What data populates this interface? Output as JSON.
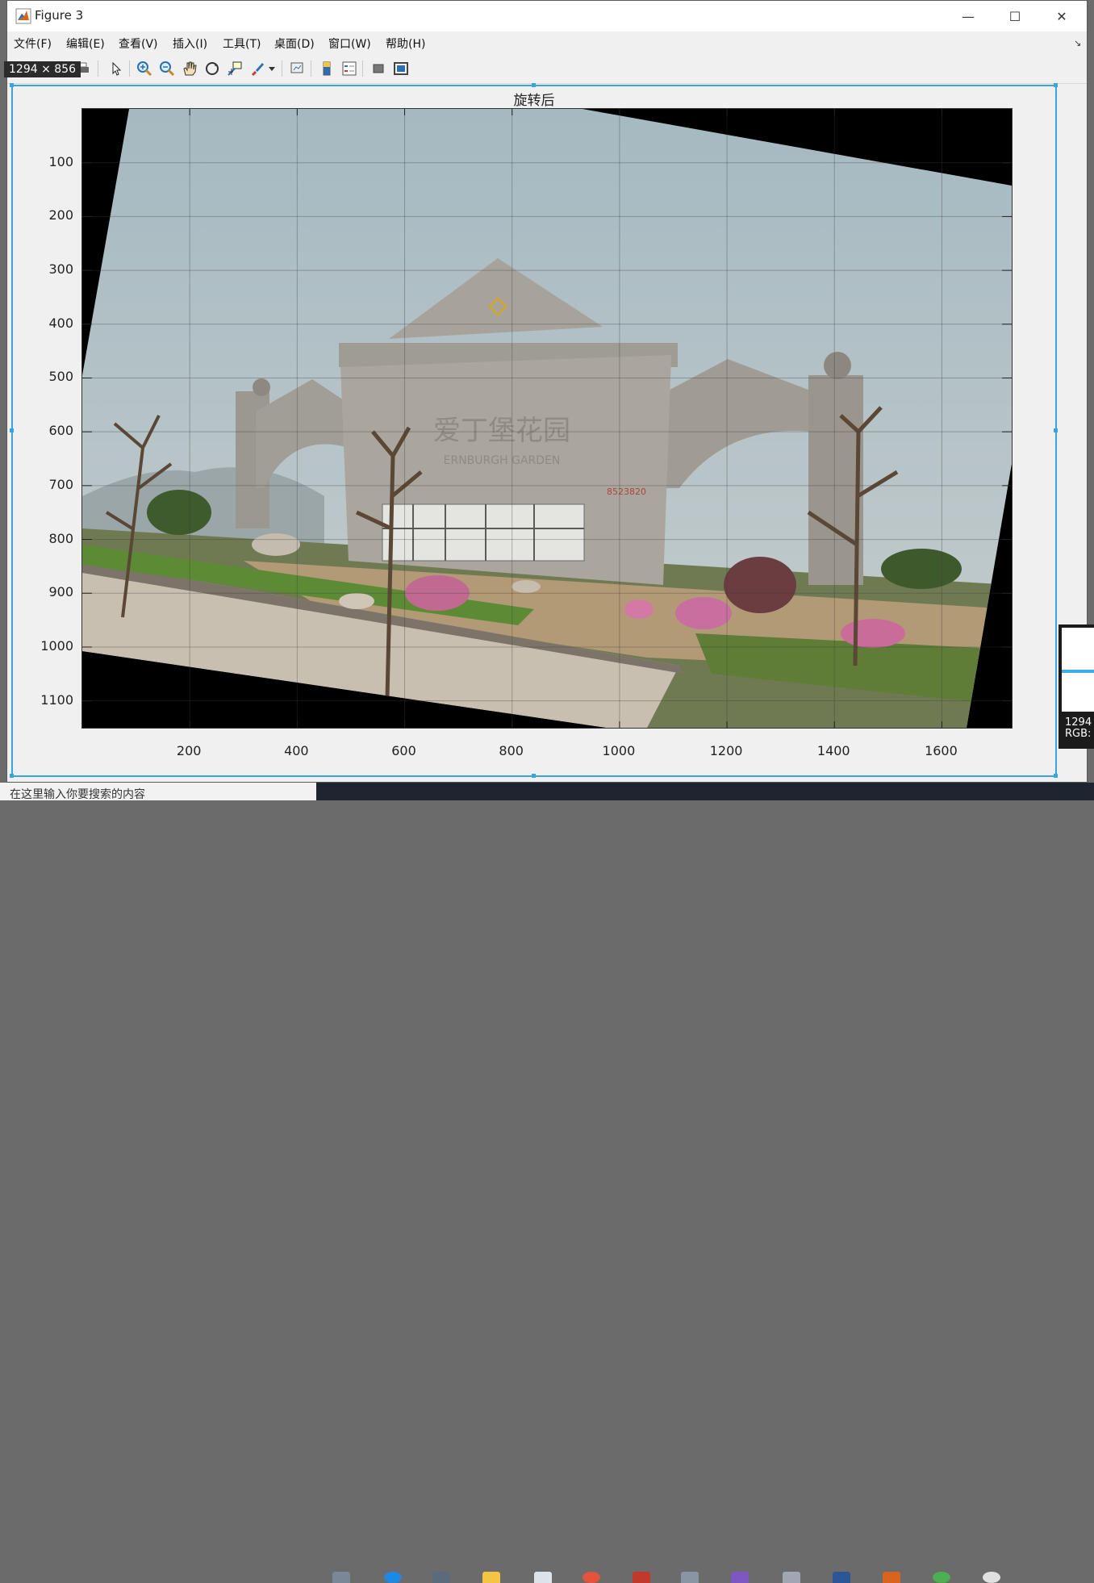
{
  "window": {
    "title": "Figure 3",
    "minimize_glyph": "—",
    "maximize_glyph": "☐",
    "close_glyph": "✕"
  },
  "menu": {
    "items": [
      "文件(F)",
      "编辑(E)",
      "查看(V)",
      "插入(I)",
      "工具(T)",
      "桌面(D)",
      "窗口(W)",
      "帮助(H)"
    ],
    "undock_glyph": "↘"
  },
  "toolbar": {
    "icons": [
      "new-figure-icon",
      "open-file-icon",
      "save-icon",
      "print-icon",
      "pointer-icon",
      "zoom-in-icon",
      "zoom-out-icon",
      "pan-hand-icon",
      "rotate-3d-icon",
      "data-cursor-icon",
      "brush-icon",
      "brush-dropdown-icon",
      "link-plot-icon",
      "colorbar-icon",
      "legend-icon",
      "hide-plot-tools-icon",
      "show-plot-tools-icon"
    ]
  },
  "dimension_badge": "1294 × 856",
  "axes": {
    "title": "旋转后",
    "x_ticks": [
      "200",
      "400",
      "600",
      "800",
      "1000",
      "1200",
      "1400",
      "1600"
    ],
    "y_ticks": [
      "100",
      "200",
      "300",
      "400",
      "500",
      "600",
      "700",
      "800",
      "900",
      "1000",
      "1100"
    ],
    "grid": true,
    "xlim": [
      0,
      1730
    ],
    "ylim": [
      0,
      1150
    ],
    "image_alt": "rotated photo of Ernburgh Garden gate"
  },
  "photo": {
    "sign_text": "爱丁堡花园",
    "sign_subtext": "ERNBURGH GARDEN",
    "phone_text": "8523820"
  },
  "side_panel": {
    "line1": "1294",
    "line2": "RGB:"
  },
  "taskbar": {
    "search_text": "在这里输入你要搜索的内容"
  },
  "colors": {
    "accent": "#39a5dc",
    "sky": "#a9bcc4"
  }
}
